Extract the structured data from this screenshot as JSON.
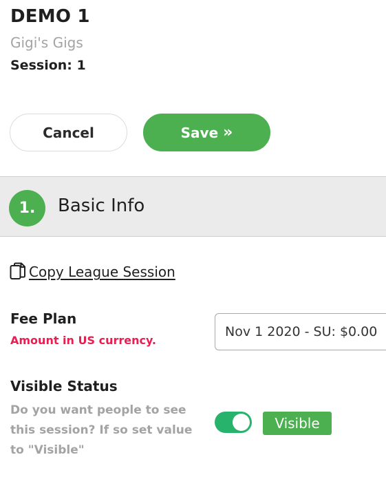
{
  "header": {
    "title": "DEMO 1",
    "organization": "Gigi's Gigs",
    "session": "Session: 1"
  },
  "actions": {
    "cancel_label": "Cancel",
    "save_label": "Save",
    "save_icon": "double-chevron-right"
  },
  "section": {
    "number": "1.",
    "title": "Basic Info"
  },
  "copy_link": {
    "label": "Copy League Session",
    "icon": "copy-icon"
  },
  "fee_plan": {
    "label": "Fee Plan",
    "hint": "Amount in US currency.",
    "selected_value": "Nov 1 2020 - SU: $0.00"
  },
  "visible_status": {
    "label": "Visible Status",
    "help_text": "Do you want people to see this session? If so set value to \"Visible\"",
    "toggle_on": true,
    "value": "Visible"
  },
  "colors": {
    "accent_green": "#4caf50",
    "toggle_green": "#27b36b",
    "hint_red": "#e91e50",
    "muted_gray": "#a3a3a3"
  }
}
